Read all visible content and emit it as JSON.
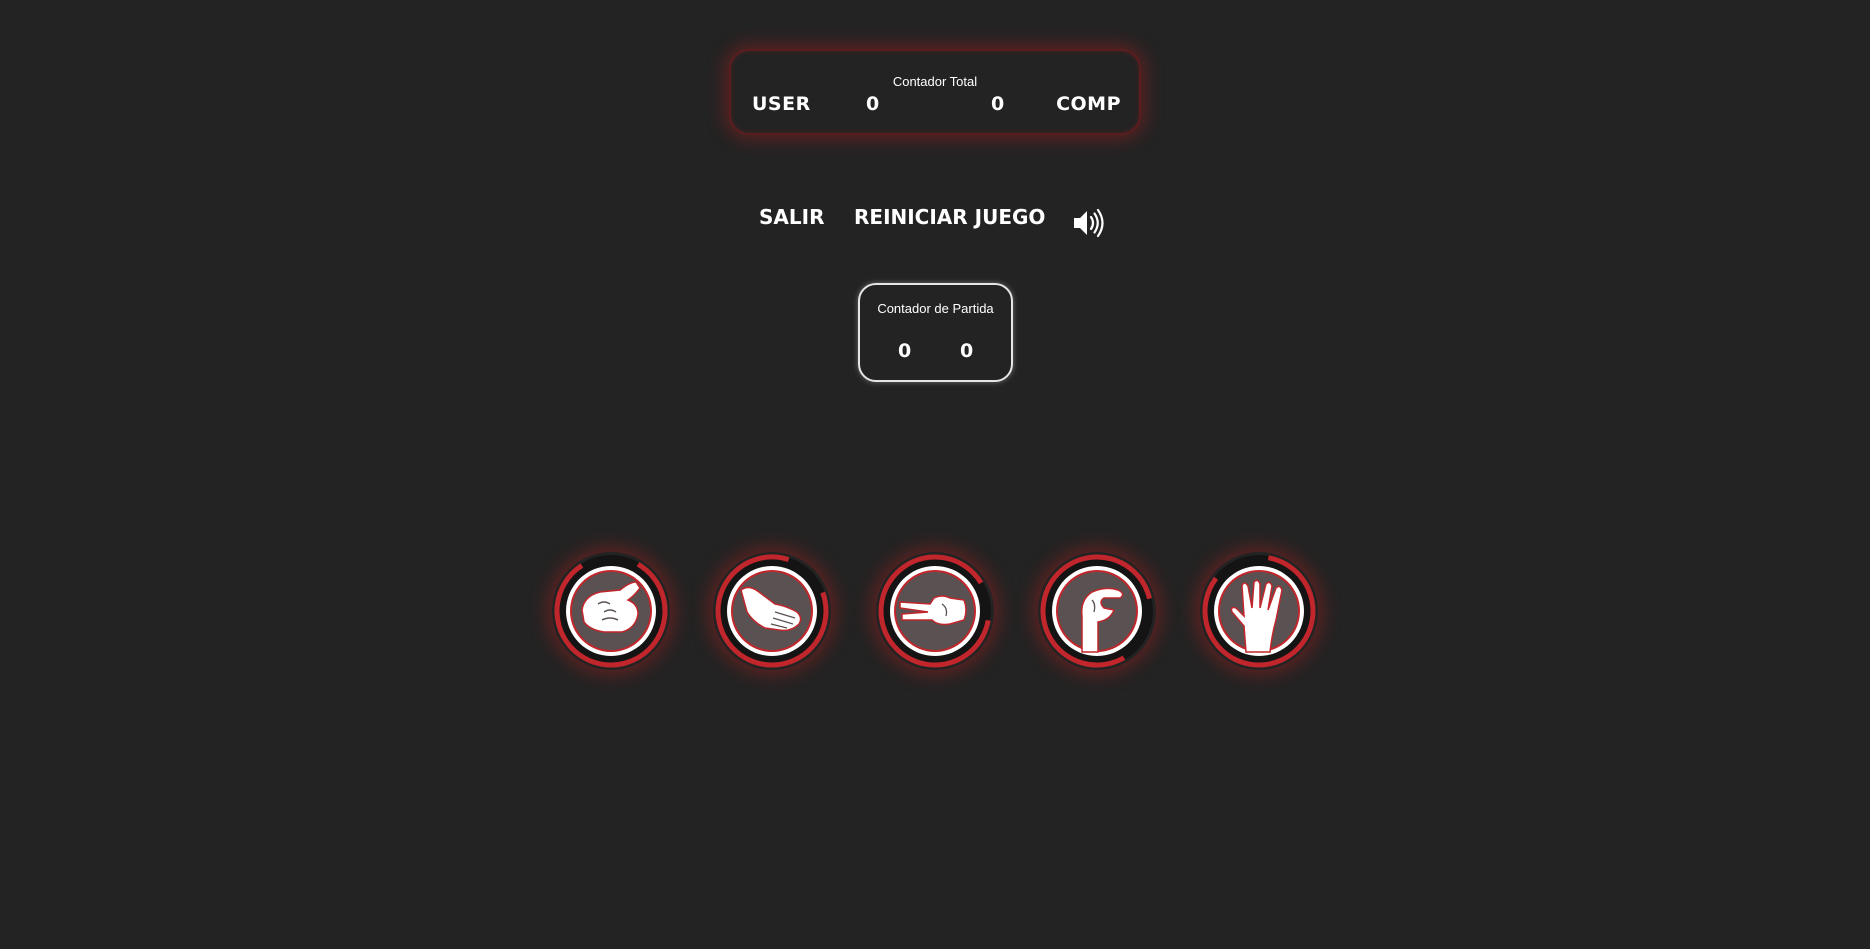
{
  "total_counter": {
    "title": "Contador Total",
    "user_label": "USER",
    "user_score": "0",
    "comp_score": "0",
    "comp_label": "COMP"
  },
  "controls": {
    "exit_label": "SALIR",
    "restart_label": "REINICIAR JUEGO",
    "sound_icon": "speaker-volume-icon"
  },
  "match_counter": {
    "title": "Contador de Partida",
    "user_score": "0",
    "comp_score": "0"
  },
  "choices": [
    {
      "name": "rock",
      "icon": "fist-hand-icon"
    },
    {
      "name": "paper",
      "icon": "open-hand-icon"
    },
    {
      "name": "scissors",
      "icon": "scissors-hand-icon"
    },
    {
      "name": "lizard",
      "icon": "lizard-hand-icon"
    },
    {
      "name": "spock",
      "icon": "vulcan-salute-hand-icon"
    }
  ],
  "colors": {
    "background": "#232323",
    "accent_red": "#c0262b",
    "ring_dark": "#141414",
    "icon_fill": "#5a5252",
    "white": "#ffffff"
  }
}
